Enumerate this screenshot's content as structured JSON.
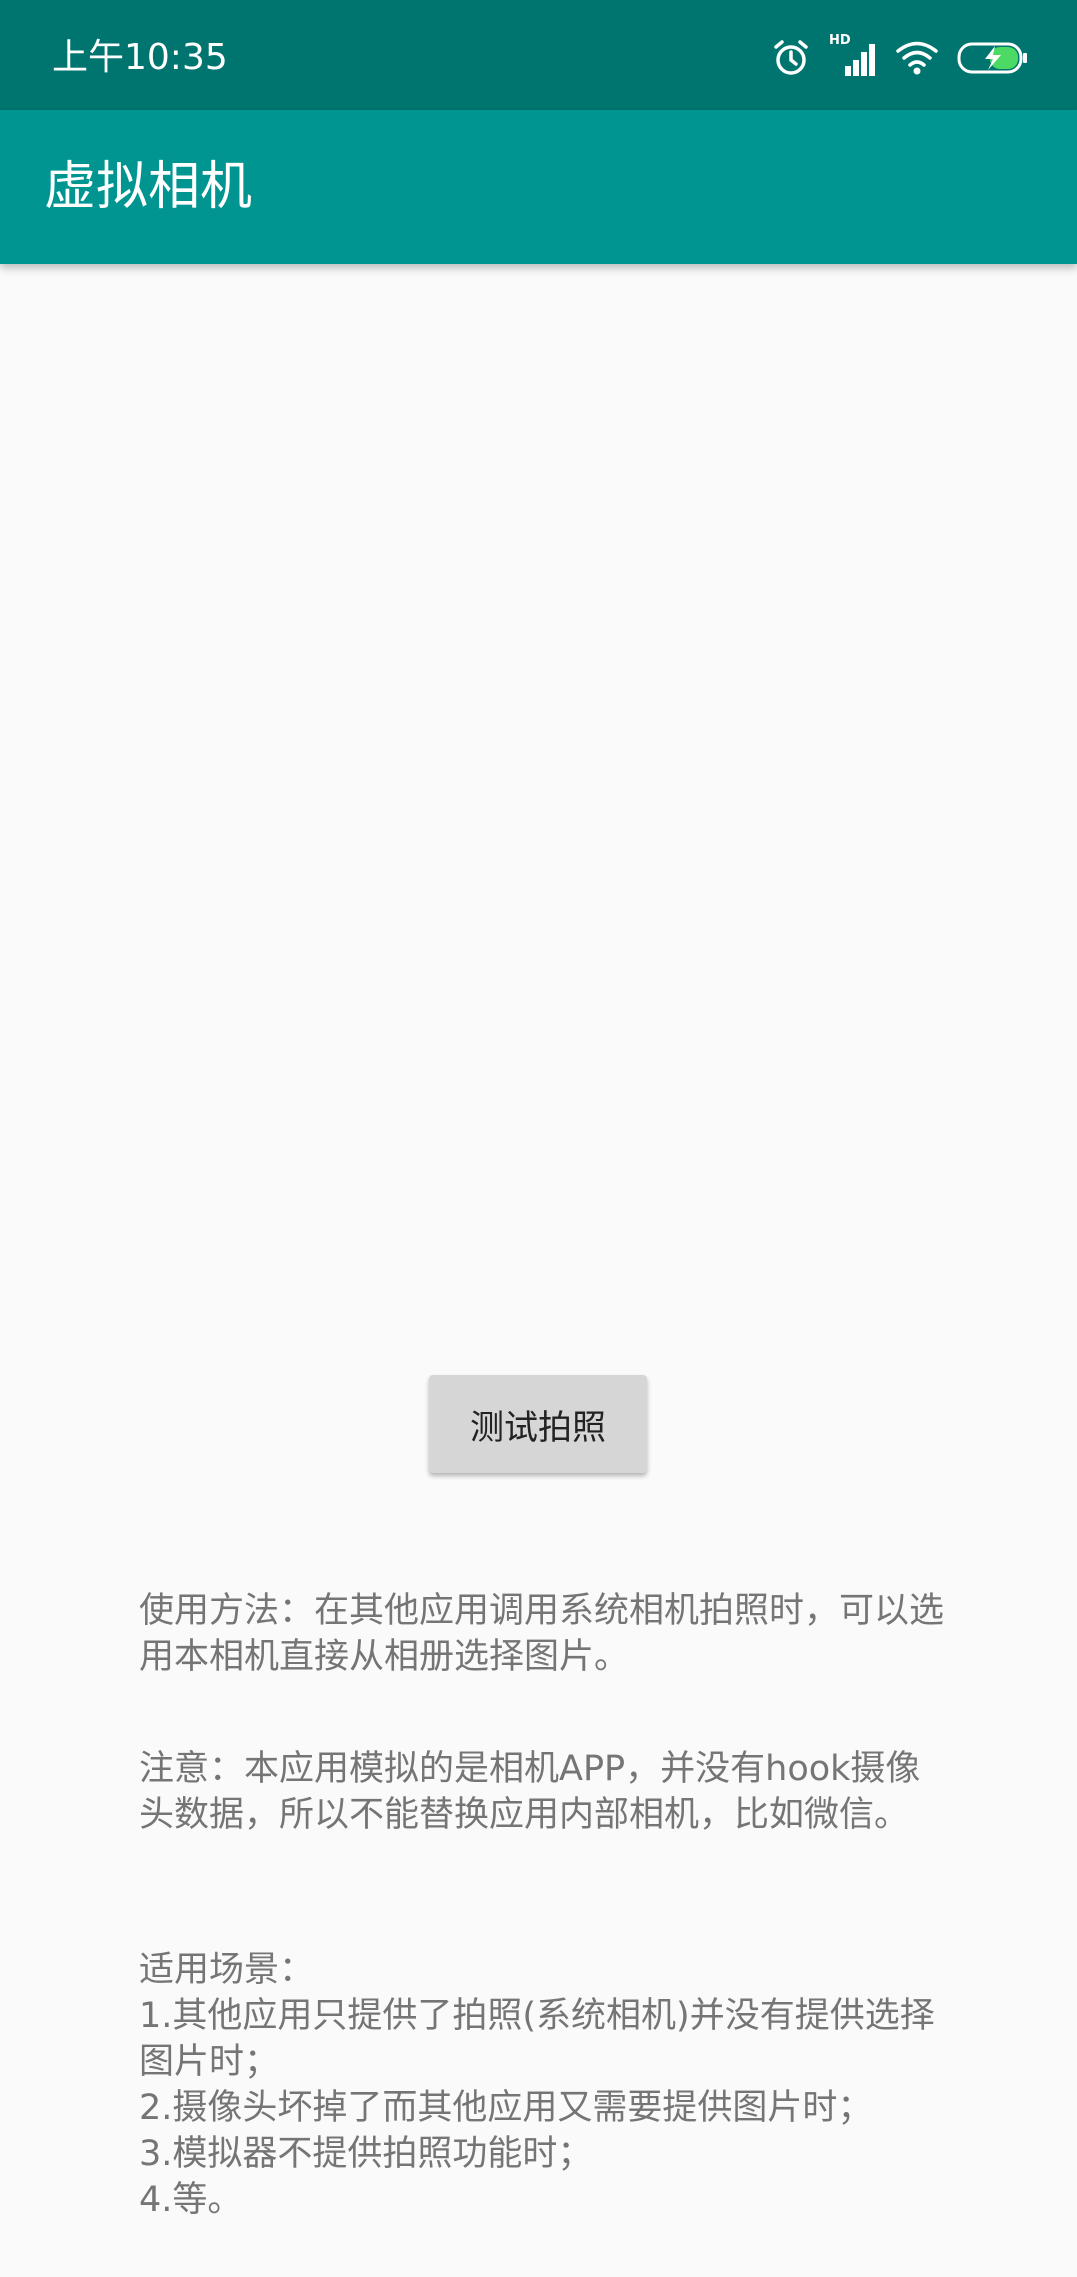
{
  "status_bar": {
    "time": "上午10:35",
    "icons": [
      "alarm-icon",
      "hd-signal-icon",
      "wifi-icon",
      "battery-charging-icon"
    ],
    "hd_label": "HD",
    "color": "#00756f"
  },
  "app_bar": {
    "title": "虚拟相机",
    "color": "#009591"
  },
  "main": {
    "test_button_label": "测试拍照",
    "usage_text": "使用方法：在其他应用调用系统相机拍照时，可以选用本相机直接从相册选择图片。",
    "note_text": "注意：本应用模拟的是相机APP，并没有hook摄像头数据，所以不能替换应用内部相机，比如微信。",
    "scenes": {
      "heading": "适用场景：",
      "items": [
        "1.其他应用只提供了拍照(系统相机)并没有提供选择图片时；",
        "2.摄像头坏掉了而其他应用又需要提供图片时；",
        "3.模拟器不提供拍照功能时；",
        "4.等。"
      ]
    }
  }
}
